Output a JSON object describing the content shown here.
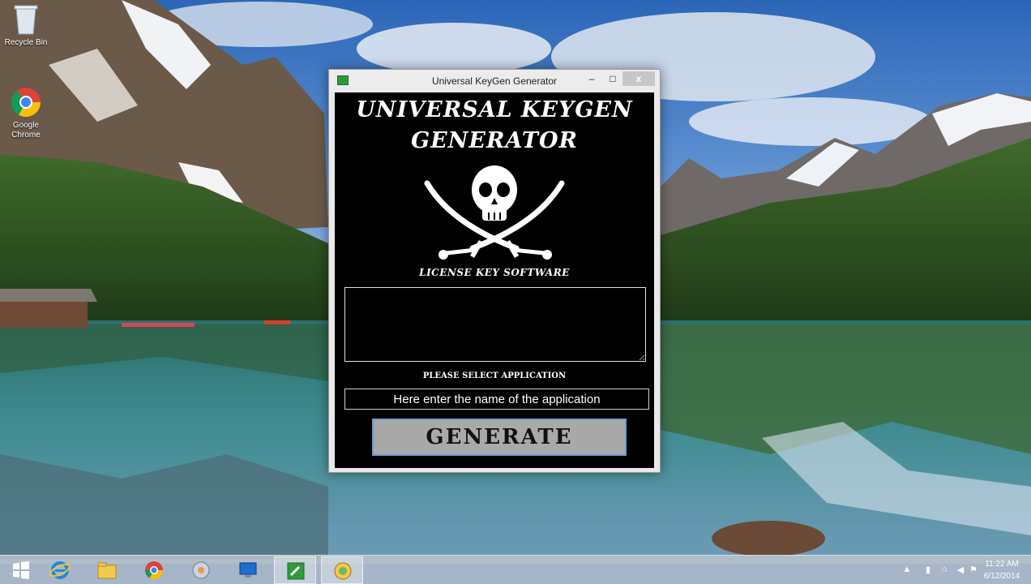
{
  "desktop": {
    "icons": [
      {
        "label": "Recycle Bin",
        "icon": "recycle-bin-icon"
      },
      {
        "label": "Google Chrome",
        "icon": "chrome-icon"
      }
    ]
  },
  "window": {
    "title": "Universal KeyGen Generator",
    "controls": {
      "minimize": "–",
      "maximize": "□",
      "close": "x"
    },
    "headline_line1": "UNIVERSAL KEYGEN",
    "headline_line2": "GENERATOR",
    "logo": "skull-crossed-swords-icon",
    "subhead": "LICENSE KEY SOFTWARE",
    "output_value": "",
    "select_label": "PLEASE SELECT APPLICATION",
    "app_input_value": "Here enter the name of the application",
    "generate_label": "GENERATE"
  },
  "taskbar": {
    "buttons": [
      "windows-start-icon",
      "internet-explorer-icon",
      "file-explorer-icon",
      "chrome-icon",
      "control-panel-icon",
      "remote-desktop-icon",
      "keygen-app-icon",
      "keygen-running-icon"
    ],
    "clock_time": "11:22 AM",
    "clock_date": "6/12/2014"
  },
  "colors": {
    "window_bg": "#000000",
    "button_bg": "#a9a9a9",
    "button_border": "#6c9ad6",
    "app_icon": "#2e9b38"
  }
}
